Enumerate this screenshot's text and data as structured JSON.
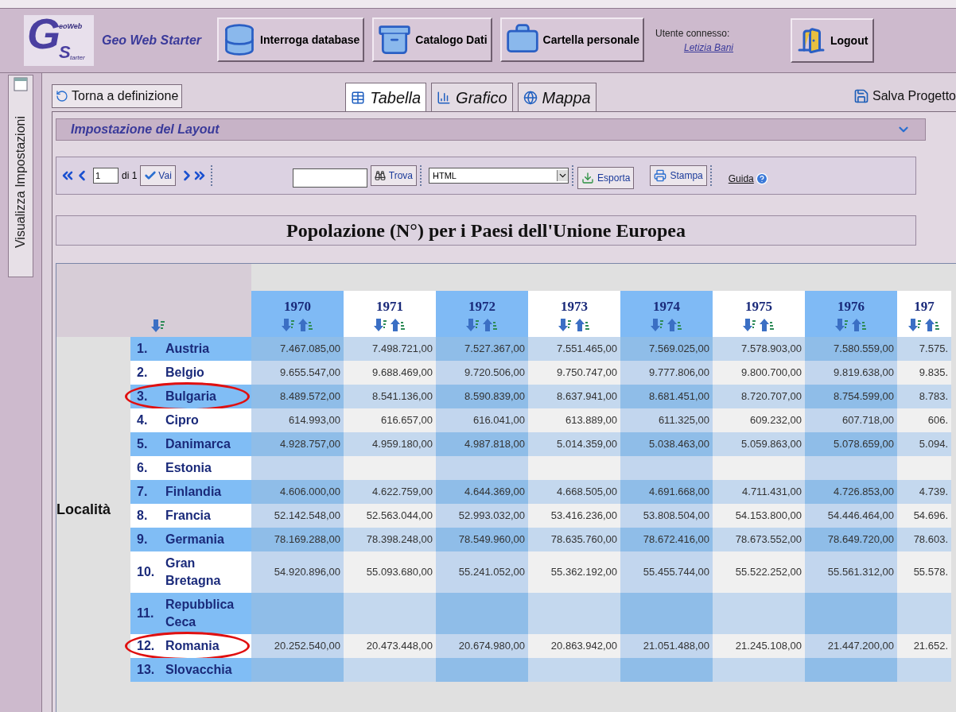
{
  "header": {
    "logo": {
      "letter_1": "G",
      "text_1": "eoWeb",
      "letter_2": "S",
      "text_2": "tarter"
    },
    "app_name": "Geo Web Starter",
    "nav_buttons": [
      {
        "label": "Interroga database",
        "kind": "database"
      },
      {
        "label": "Catalogo Dati",
        "kind": "catalog"
      },
      {
        "label": "Cartella personale",
        "kind": "briefcase"
      }
    ],
    "user": {
      "label": "Utente connesso:",
      "name": "Letizia Bani"
    },
    "logout": "Logout"
  },
  "side_tab": "Visualizza Impostazioni",
  "toolbar": {
    "back": "Torna a definizione",
    "view_tabs": [
      {
        "label": "Tabella",
        "kind": "table",
        "selected": true
      },
      {
        "label": "Grafico",
        "kind": "chart",
        "selected": false
      },
      {
        "label": "Mappa",
        "kind": "globe",
        "selected": false
      }
    ],
    "save": "Salva Progetto"
  },
  "layout_panel": {
    "title": "Impostazione del Layout",
    "expanded": false
  },
  "pager": {
    "page": "1",
    "of": "di 1",
    "go": "Vai",
    "find": "Trova",
    "format": "HTML",
    "export": "Esporta",
    "print": "Stampa",
    "help": "Guida"
  },
  "report_title": "Popolazione (N°) per i Paesi dell'Unione Europea",
  "table": {
    "row_dimension": "Località",
    "columns": [
      "1970",
      "1971",
      "1972",
      "1973",
      "1974",
      "1975",
      "1976",
      "197"
    ],
    "rows": [
      {
        "number": "1.",
        "name": "Austria",
        "circled": false,
        "values": [
          "7.467.085,00",
          "7.498.721,00",
          "7.527.367,00",
          "7.551.465,00",
          "7.569.025,00",
          "7.578.903,00",
          "7.580.559,00",
          "7.575."
        ]
      },
      {
        "number": "2.",
        "name": "Belgio",
        "circled": false,
        "values": [
          "9.655.547,00",
          "9.688.469,00",
          "9.720.506,00",
          "9.750.747,00",
          "9.777.806,00",
          "9.800.700,00",
          "9.819.638,00",
          "9.835."
        ]
      },
      {
        "number": "3.",
        "name": "Bulgaria",
        "circled": true,
        "values": [
          "8.489.572,00",
          "8.541.136,00",
          "8.590.839,00",
          "8.637.941,00",
          "8.681.451,00",
          "8.720.707,00",
          "8.754.599,00",
          "8.783."
        ]
      },
      {
        "number": "4.",
        "name": "Cipro",
        "circled": false,
        "values": [
          "614.993,00",
          "616.657,00",
          "616.041,00",
          "613.889,00",
          "611.325,00",
          "609.232,00",
          "607.718,00",
          "606."
        ]
      },
      {
        "number": "5.",
        "name": "Danimarca",
        "circled": false,
        "values": [
          "4.928.757,00",
          "4.959.180,00",
          "4.987.818,00",
          "5.014.359,00",
          "5.038.463,00",
          "5.059.863,00",
          "5.078.659,00",
          "5.094."
        ]
      },
      {
        "number": "6.",
        "name": "Estonia",
        "circled": false
      },
      {
        "number": "7.",
        "name": "Finlandia",
        "circled": false,
        "values": [
          "4.606.000,00",
          "4.622.759,00",
          "4.644.369,00",
          "4.668.505,00",
          "4.691.668,00",
          "4.711.431,00",
          "4.726.853,00",
          "4.739."
        ]
      },
      {
        "number": "8.",
        "name": "Francia",
        "circled": false,
        "values": [
          "52.142.548,00",
          "52.563.044,00",
          "52.993.032,00",
          "53.416.236,00",
          "53.808.504,00",
          "54.153.800,00",
          "54.446.464,00",
          "54.696."
        ]
      },
      {
        "number": "9.",
        "name": "Germania",
        "circled": false,
        "values": [
          "78.169.288,00",
          "78.398.248,00",
          "78.549.960,00",
          "78.635.760,00",
          "78.672.416,00",
          "78.673.552,00",
          "78.649.720,00",
          "78.603."
        ]
      },
      {
        "number": "10.",
        "name": "Gran Bretagna",
        "circled": false,
        "values": [
          "54.920.896,00",
          "55.093.680,00",
          "55.241.052,00",
          "55.362.192,00",
          "55.455.744,00",
          "55.522.252,00",
          "55.561.312,00",
          "55.578."
        ]
      },
      {
        "number": "11.",
        "name": "Repubblica Ceca",
        "circled": false
      },
      {
        "number": "12.",
        "name": "Romania",
        "circled": true,
        "values": [
          "20.252.540,00",
          "20.473.448,00",
          "20.674.980,00",
          "20.863.942,00",
          "21.051.488,00",
          "21.245.108,00",
          "21.447.200,00",
          "21.652."
        ]
      },
      {
        "number": "13.",
        "name": "Slovacchia",
        "circled": false
      }
    ]
  }
}
